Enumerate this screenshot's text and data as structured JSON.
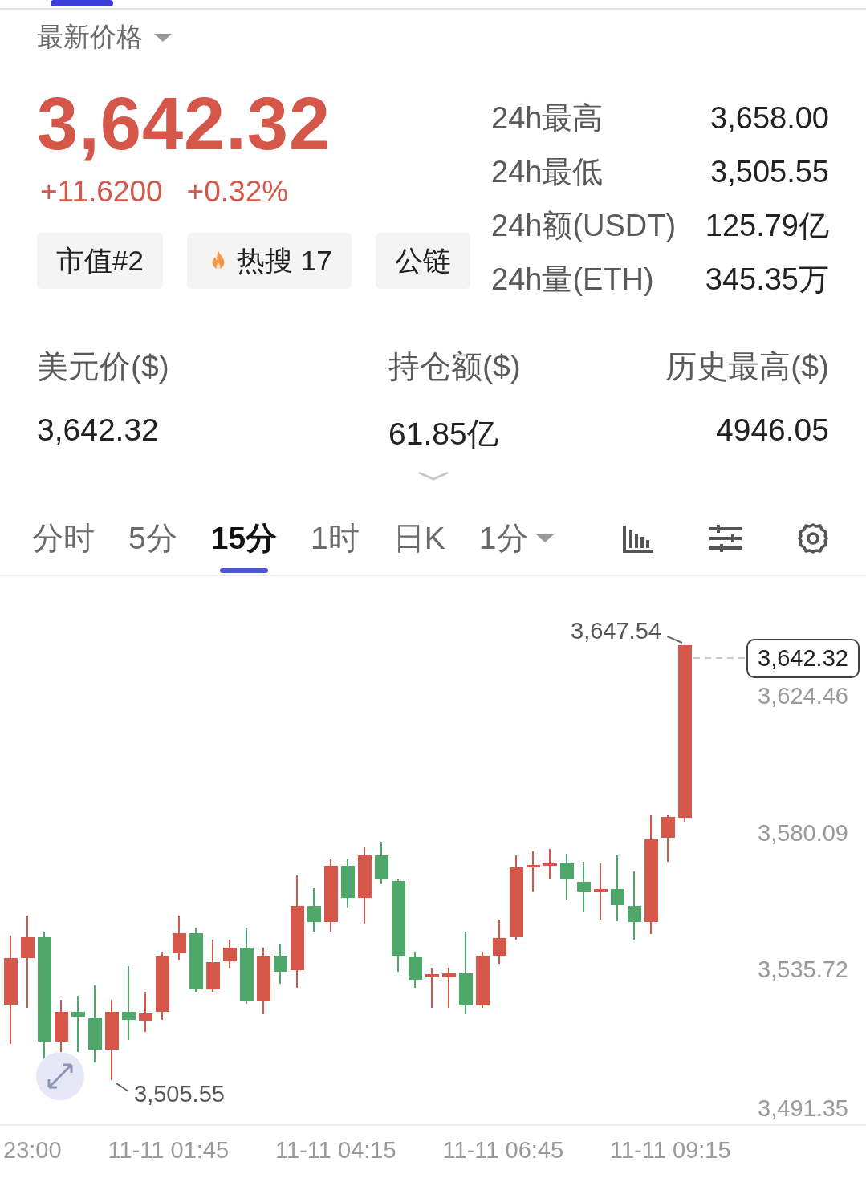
{
  "price_selector": {
    "label": "最新价格"
  },
  "price": {
    "last": "3,642.32",
    "change": "+11.6200",
    "change_pct": "+0.32%"
  },
  "tags": [
    {
      "label": "市值#2",
      "kind": "plain"
    },
    {
      "label": "热搜 17",
      "kind": "hot"
    },
    {
      "label": "公链",
      "kind": "plain"
    }
  ],
  "stats_24h": [
    {
      "label": "24h最高",
      "value": "3,658.00"
    },
    {
      "label": "24h最低",
      "value": "3,505.55"
    },
    {
      "label": "24h额(USDT)",
      "value": "125.79亿"
    },
    {
      "label": "24h量(ETH)",
      "value": "345.35万"
    }
  ],
  "metrics": [
    {
      "label": "美元价($)",
      "value": "3,642.32"
    },
    {
      "label": "持仓额($)",
      "value": "61.85亿"
    },
    {
      "label": "历史最高($)",
      "value": "4946.05"
    }
  ],
  "intervals": [
    {
      "label": "分时",
      "selected": false,
      "dropdown": false
    },
    {
      "label": "5分",
      "selected": false,
      "dropdown": false
    },
    {
      "label": "15分",
      "selected": true,
      "dropdown": false
    },
    {
      "label": "1时",
      "selected": false,
      "dropdown": false
    },
    {
      "label": "日K",
      "selected": false,
      "dropdown": false
    },
    {
      "label": "1分",
      "selected": false,
      "dropdown": true
    }
  ],
  "chart": {
    "high_label": "3,647.54",
    "low_label": "3,505.55",
    "current_price": "3,642.32",
    "y_labels": [
      "3,624.46",
      "3,580.09",
      "3,535.72",
      "3,491.35"
    ],
    "x_labels": [
      "23:00",
      "11-11 01:45",
      "11-11 04:15",
      "11-11 06:45",
      "11-11 09:15"
    ]
  }
}
